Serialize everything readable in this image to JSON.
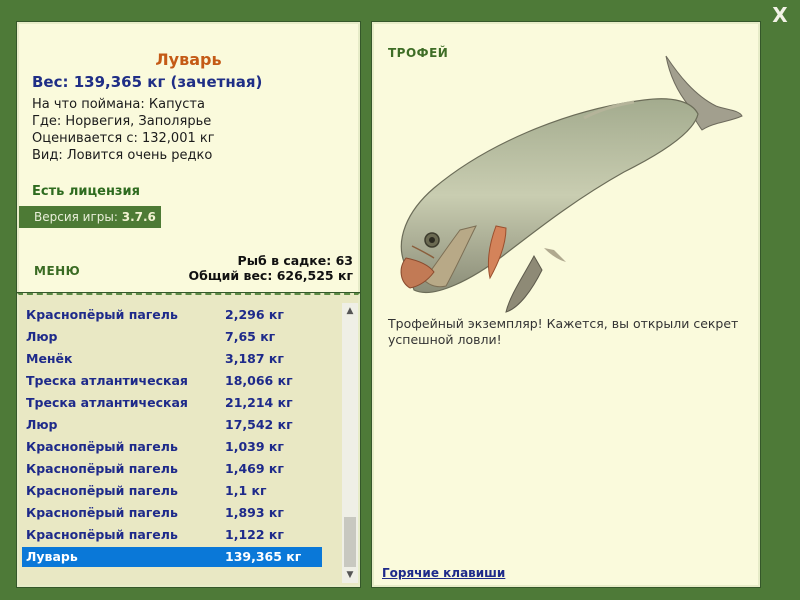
{
  "close_label": "X",
  "fish": {
    "name": "Луварь",
    "weight_line": "Вес: 139,365 кг (зачетная)",
    "lines": [
      "На что поймана: Капуста",
      "Где: Норвегия, Заполярье",
      "Оценивается с: 132,001 кг",
      "Вид: Ловится очень редко"
    ]
  },
  "license": "Есть лицензия",
  "version": {
    "label": "Версия игры:",
    "value": "3.7.6"
  },
  "menu_label": "МЕНЮ",
  "stats": {
    "count_line": "Рыб в садке: 63",
    "total_line": "Общий вес: 626,525 кг"
  },
  "catch_list": [
    {
      "name": "Краснопёрый пагель",
      "weight": "2,296 кг"
    },
    {
      "name": "Люр",
      "weight": "7,65 кг"
    },
    {
      "name": "Менёк",
      "weight": "3,187 кг"
    },
    {
      "name": "Треска атлантическая",
      "weight": "18,066 кг"
    },
    {
      "name": "Треска атлантическая",
      "weight": "21,214 кг"
    },
    {
      "name": "Люр",
      "weight": "17,542 кг"
    },
    {
      "name": "Краснопёрый пагель",
      "weight": "1,039 кг"
    },
    {
      "name": "Краснопёрый пагель",
      "weight": "1,469 кг"
    },
    {
      "name": "Краснопёрый пагель",
      "weight": "1,1 кг"
    },
    {
      "name": "Краснопёрый пагель",
      "weight": "1,893 кг"
    },
    {
      "name": "Краснопёрый пагель",
      "weight": "1,122 кг"
    },
    {
      "name": "Луварь",
      "weight": "139,365 кг",
      "selected": true
    }
  ],
  "trophy": {
    "label": "ТРОФЕЙ",
    "description": "Трофейный экземпляр! Кажется, вы открыли секрет успешной ловли!",
    "hotkeys": "Горячие клавиши"
  },
  "colors": {
    "background": "#4e7a38",
    "panel": "#fafadc",
    "list_bg": "#e9e8c4",
    "selected": "#0a78d8",
    "fish_name": "#c45a16",
    "link": "#1e2a8a"
  }
}
